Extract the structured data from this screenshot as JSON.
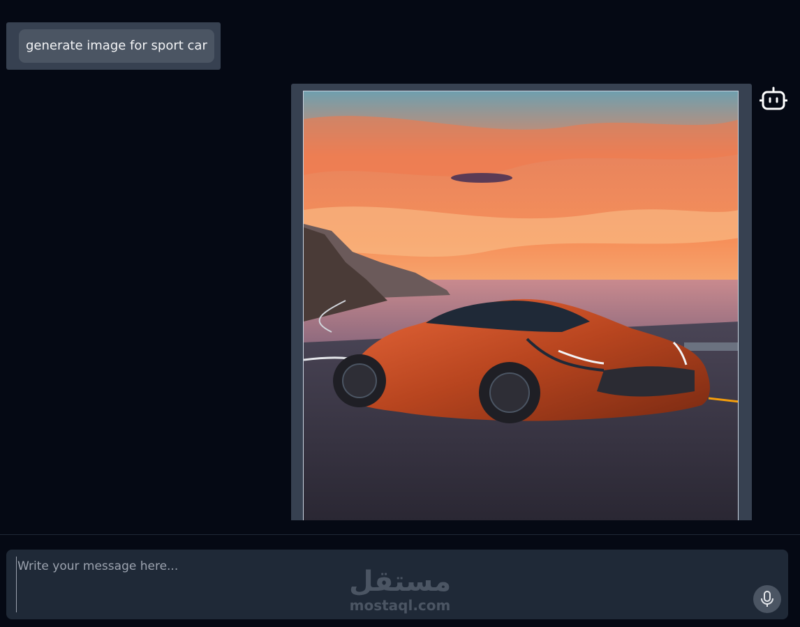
{
  "conversation": {
    "user_message": "generate image for sport car",
    "bot_response": {
      "image_alt": "sport car at sunset",
      "avatar_icon": "robot-icon"
    }
  },
  "composer": {
    "placeholder": "Write your message here...",
    "mic_icon": "microphone-icon"
  },
  "watermark": {
    "arabic": "مستقل",
    "latin": "mostaql.com"
  },
  "colors": {
    "background": "#050914",
    "panel": "#374151",
    "bubble": "#4b5563",
    "composer": "#1f2937",
    "car": "#c2410c"
  }
}
